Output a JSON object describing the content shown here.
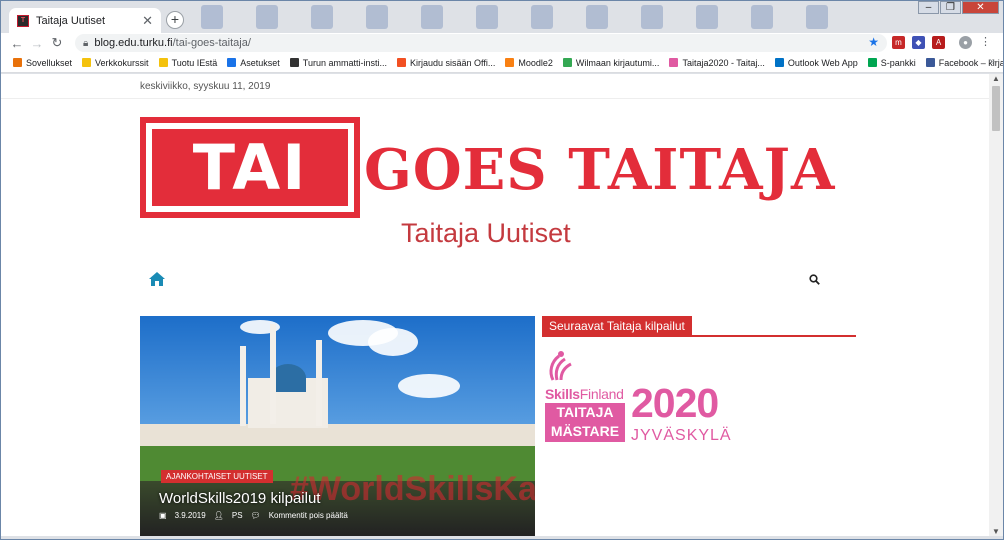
{
  "browser": {
    "tab_title": "Taitaja Uutiset",
    "url_host": "blog.edu.turku.fi",
    "url_path": "/tai-goes-taitaja/"
  },
  "bookmarks": [
    {
      "label": "Sovellukset",
      "color": "#e8710a"
    },
    {
      "label": "Verkkokurssit",
      "color": "#f4c20d"
    },
    {
      "label": "Tuotu IEstä",
      "color": "#f4c20d"
    },
    {
      "label": "Asetukset",
      "color": "#1a73e8"
    },
    {
      "label": "Turun ammatti-insti...",
      "color": "#333333"
    },
    {
      "label": "Kirjaudu sisään Offi...",
      "color": "#f25022"
    },
    {
      "label": "Moodle2",
      "color": "#f98012"
    },
    {
      "label": "Wilmaan kirjautumi...",
      "color": "#34a853"
    },
    {
      "label": "Taitaja2020 - Taitaj...",
      "color": "#e05aa2"
    },
    {
      "label": "Outlook Web App",
      "color": "#0072c6"
    },
    {
      "label": "S-pankki",
      "color": "#00a651"
    },
    {
      "label": "Facebook – kirjaud...",
      "color": "#3b5998"
    }
  ],
  "page": {
    "date": "keskiviikko, syyskuu 11, 2019",
    "logo_box_text": "TAI",
    "logo_rest_text": "GOES TAITAJA",
    "subtitle": "Taitaja Uutiset",
    "brand_color": "#e32d3a"
  },
  "featured_post": {
    "category": "AJANKOHTAISET UUTISET",
    "title": "WorldSkills2019 kilpailut",
    "date": "3.9.2019",
    "author": "PS",
    "comments": "Kommentit pois päältä"
  },
  "sidebar": {
    "title": "Seuraavat Taitaja kilpailut",
    "skills_bold": "Skills",
    "skills_thin": "Finland",
    "box_line1": "TAITAJA",
    "box_line2": "MÄSTARE",
    "year": "2020",
    "city": "JYVÄSKYLÄ"
  }
}
